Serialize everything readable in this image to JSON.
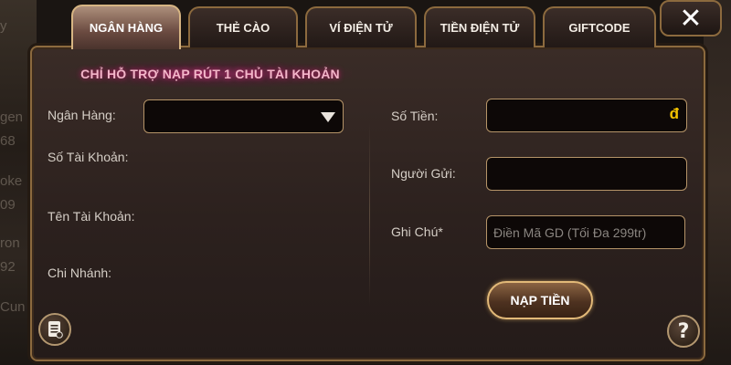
{
  "background_fragments": [
    "y",
    "gen",
    "68",
    "oke",
    "09",
    "ron",
    "92",
    "Cun"
  ],
  "tabs": [
    {
      "label": "NGÂN HÀNG",
      "active": true
    },
    {
      "label": "THẺ CÀO",
      "active": false
    },
    {
      "label": "VÍ ĐIỆN TỬ",
      "active": false
    },
    {
      "label": "TIỀN ĐIỆN TỬ",
      "active": false
    },
    {
      "label": "GIFTCODE",
      "active": false
    }
  ],
  "close_icon": "✕",
  "notice": "CHỈ HỖ TRỢ NẠP RÚT 1 CHỦ TÀI KHOẢN",
  "left_form": {
    "bank_label": "Ngân Hàng:",
    "bank_value": "",
    "account_number_label": "Số Tài Khoản:",
    "account_name_label": "Tên Tài Khoản:",
    "branch_label": "Chi Nhánh:"
  },
  "right_form": {
    "amount_label": "Số Tiền:",
    "amount_value": "",
    "currency_symbol": "đ",
    "sender_label": "Người Gửi:",
    "sender_value": "",
    "note_label": "Ghi Chú*",
    "note_placeholder": "Điền Mã GD (Tối Đa 299tr)"
  },
  "submit_label": "NẠP TIỀN",
  "icons": {
    "history": "history-icon",
    "help": "help-icon",
    "close": "close-icon",
    "dropdown": "chevron-down-icon"
  },
  "colors": {
    "accent_gold": "#b59468",
    "currency": "#f3c200",
    "notice_text": "#f3b6c9"
  }
}
